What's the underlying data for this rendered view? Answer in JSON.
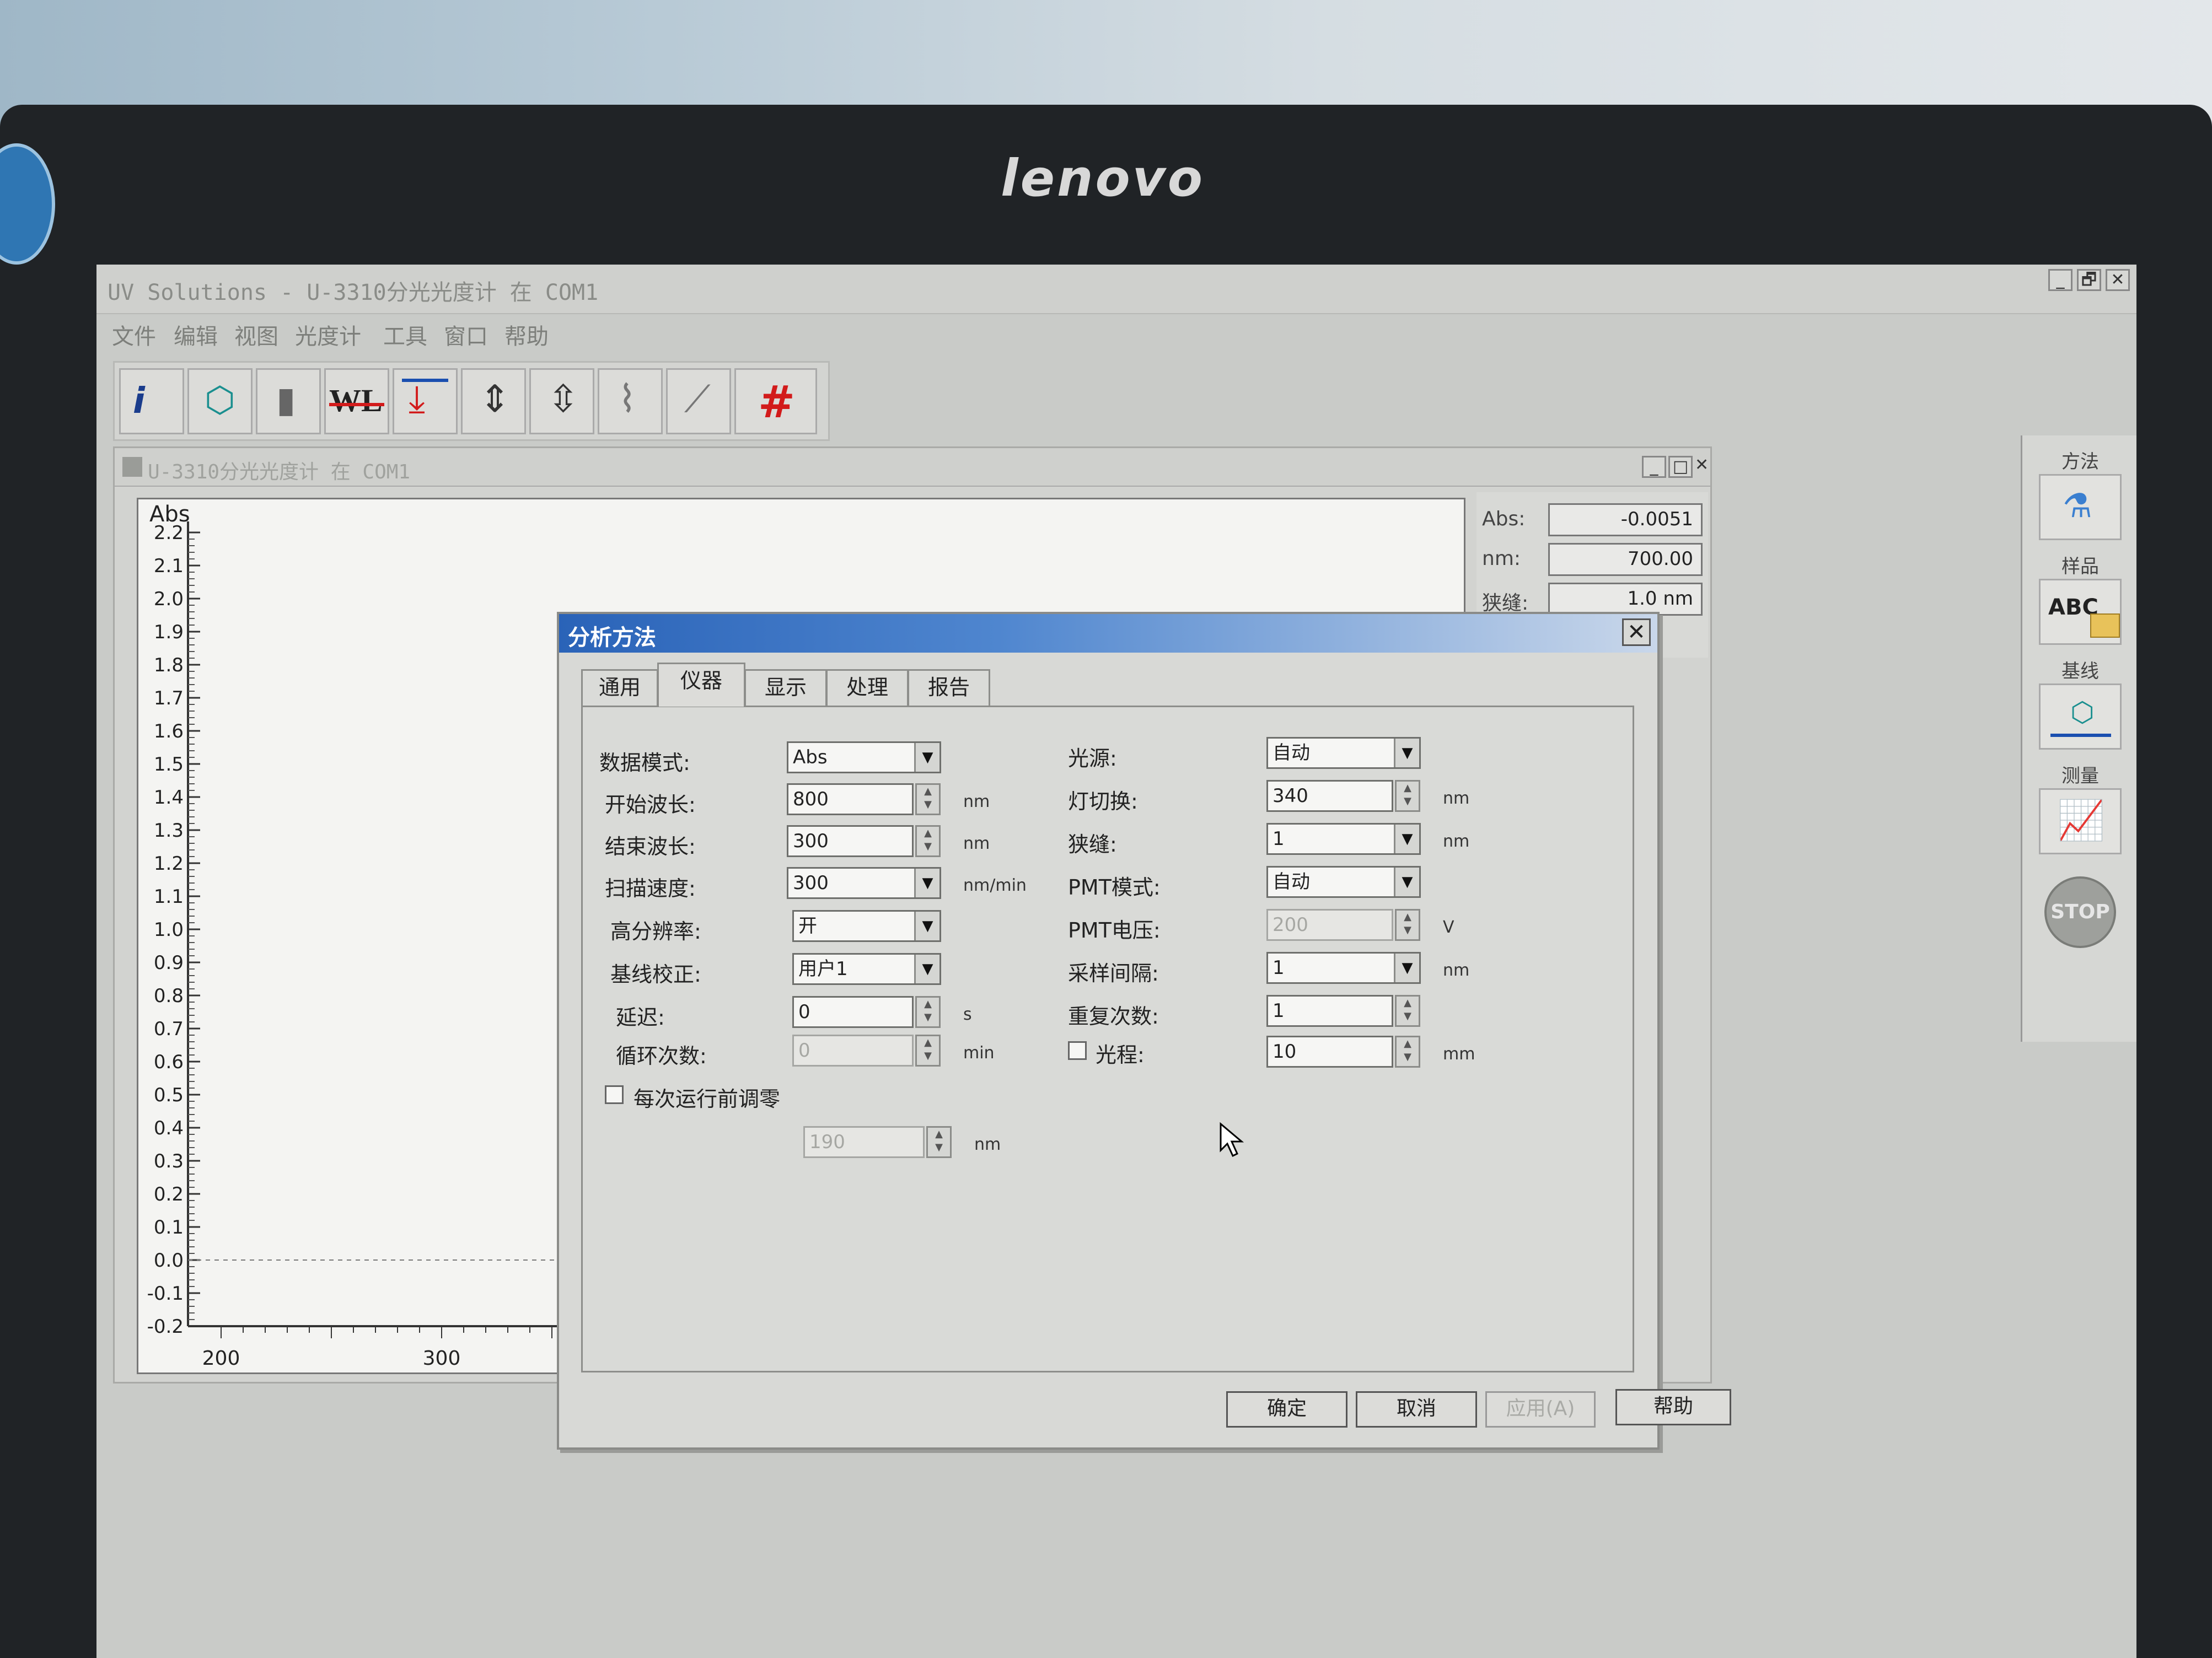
{
  "monitor": {
    "brand": "lenovo"
  },
  "app": {
    "title": "UV Solutions - U-3310分光光度计 在 COM1",
    "window_controls": [
      "_",
      "🗗",
      "✕"
    ]
  },
  "menu": [
    "文件",
    "编辑",
    "视图",
    "光度计",
    "工具",
    "窗口",
    "帮助"
  ],
  "toolbar": {
    "tools": [
      {
        "icon": "info-icon",
        "glyph": "i"
      },
      {
        "icon": "sample-cell-icon",
        "glyph": "⬡"
      },
      {
        "icon": "cuvette-icon",
        "glyph": "▮"
      },
      {
        "icon": "wavelength-icon",
        "glyph": "WL"
      },
      {
        "icon": "baseline-down-icon",
        "glyph": "⤓"
      },
      {
        "icon": "expand-vertical-icon",
        "glyph": "⇕"
      },
      {
        "icon": "compress-vertical-icon",
        "glyph": "⇳"
      },
      {
        "icon": "peak-pick-icon",
        "glyph": "⌇"
      },
      {
        "icon": "derivative-icon",
        "glyph": "⟋"
      },
      {
        "icon": "grid-icon",
        "glyph": "#"
      }
    ]
  },
  "palette": {
    "method_label": "方法",
    "sample_label": "样品",
    "baseline_label": "基线",
    "measure_label": "测量",
    "stop_label": "STOP"
  },
  "child_window": {
    "title": "U-3310分光光度计 在 COM1",
    "readout": {
      "abs_label": "Abs:",
      "abs_value": "-0.0051",
      "nm_label": "nm:",
      "nm_value": "700.00",
      "slit_label": "狭缝:",
      "slit_value": "1.0 nm"
    }
  },
  "chart_data": {
    "type": "line",
    "ylabel": "Abs",
    "xlabel": "",
    "ylim": [
      -0.2,
      2.2
    ],
    "yticks": [
      "2.2",
      "2.1",
      "2.0",
      "1.9",
      "1.8",
      "1.7",
      "1.6",
      "1.5",
      "1.4",
      "1.3",
      "1.2",
      "1.1",
      "1.0",
      "0.9",
      "0.8",
      "0.7",
      "0.6",
      "0.5",
      "0.4",
      "0.3",
      "0.2",
      "0.1",
      "0.0",
      "-0.1",
      "-0.2"
    ],
    "xticks": [
      "200",
      "300"
    ],
    "baseline_y": 0.0,
    "series": []
  },
  "dialog": {
    "title": "分析方法",
    "close": "✕",
    "tabs": [
      "通用",
      "仪器",
      "显示",
      "处理",
      "报告"
    ],
    "active_tab": "仪器",
    "left": {
      "data_mode_label": "数据模式:",
      "data_mode": "Abs",
      "start_wl_label": "开始波长:",
      "start_wl": "800",
      "start_wl_unit": "nm",
      "end_wl_label": "结束波长:",
      "end_wl": "300",
      "end_wl_unit": "nm",
      "scan_speed_label": "扫描速度:",
      "scan_speed": "300",
      "scan_speed_unit": "nm/min",
      "high_res_label": "高分辨率:",
      "high_res": "开",
      "baseline_label": "基线校正:",
      "baseline": "用户1",
      "delay_label": "延迟:",
      "delay": "0",
      "delay_unit": "s",
      "cycle_label": "循环次数:",
      "cycle": "0",
      "cycle_unit": "min",
      "autozero_label": "每次运行前调零",
      "autozero_wl": "190",
      "autozero_unit": "nm"
    },
    "right": {
      "source_label": "光源:",
      "source": "自动",
      "lamp_switch_label": "灯切换:",
      "lamp_switch": "340",
      "lamp_switch_unit": "nm",
      "slit_label": "狭缝:",
      "slit": "1",
      "slit_unit": "nm",
      "pmt_mode_label": "PMT模式:",
      "pmt_mode": "自动",
      "pmt_voltage_label": "PMT电压:",
      "pmt_voltage": "200",
      "pmt_voltage_unit": "V",
      "interval_label": "采样间隔:",
      "interval": "1",
      "interval_unit": "nm",
      "repeat_label": "重复次数:",
      "repeat": "1",
      "path_label": "光程:",
      "path": "10",
      "path_unit": "mm"
    },
    "buttons": {
      "ok": "确定",
      "cancel": "取消",
      "apply": "应用(A)",
      "help": "帮助"
    }
  }
}
